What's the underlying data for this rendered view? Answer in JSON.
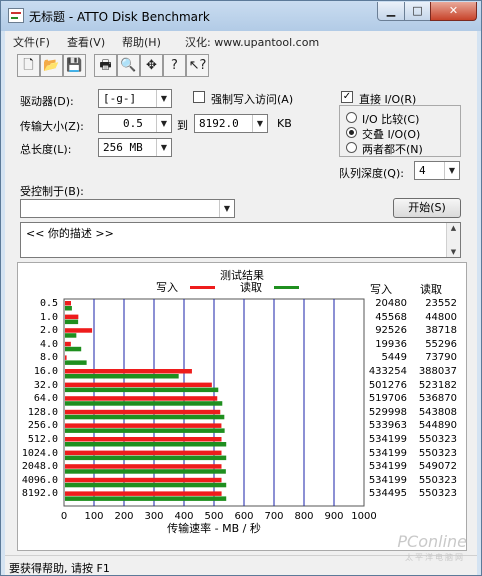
{
  "window": {
    "title": "无标题 - ATTO Disk Benchmark",
    "icon": "app-icon"
  },
  "menu": {
    "file": "文件(F)",
    "view": "查看(V)",
    "help": "帮助(H)",
    "localized": "汉化: www.upantool.com"
  },
  "toolbar": [
    "new-icon",
    "open-icon",
    "save-icon",
    "print-icon",
    "print-preview-icon",
    "move-icon",
    "help-icon",
    "context-help-icon"
  ],
  "form": {
    "drive_label": "驱动器(D):",
    "drive_value": "[-g-]",
    "force_write_label": "强制写入访问(A)",
    "force_write_checked": false,
    "transfer_label": "传输大小(Z):",
    "transfer_from": "0.5",
    "to_label": "到",
    "transfer_to": "8192.0",
    "kb_label": "KB",
    "total_label": "总长度(L):",
    "total_value": "256 MB",
    "direct_io_label": "直接 I/O(R)",
    "direct_io_checked": true,
    "radio_compare": "I/O 比较(C)",
    "radio_overlap": "交叠 I/O(O)",
    "radio_neither": "两者都不(N)",
    "selected_radio": "overlap",
    "queue_label": "队列深度(Q):",
    "queue_value": "4",
    "controlled_label": "受控制于(B):",
    "controlled_value": "",
    "start_button": "开始(S)",
    "description": "<<  你的描述  >>"
  },
  "results": {
    "title": "测试结果",
    "write_legend": "写入",
    "read_legend": "读取",
    "write_col": "写入",
    "read_col": "读取",
    "write_color": "#ee1c1c",
    "read_color": "#1f8f1f",
    "grid_color": "#1a22a8"
  },
  "chart_data": {
    "type": "bar",
    "orientation": "horizontal",
    "categories": [
      "0.5",
      "1.0",
      "2.0",
      "4.0",
      "8.0",
      "16.0",
      "32.0",
      "64.0",
      "128.0",
      "256.0",
      "512.0",
      "1024.0",
      "2048.0",
      "4096.0",
      "8192.0"
    ],
    "series": [
      {
        "name": "写入",
        "values": [
          20480,
          45568,
          92526,
          19936,
          5449,
          433254,
          501276,
          519706,
          529998,
          533963,
          534199,
          534199,
          534199,
          534199,
          534495
        ]
      },
      {
        "name": "读取",
        "values": [
          23552,
          44800,
          38718,
          55296,
          73790,
          388037,
          523182,
          536870,
          543808,
          544890,
          550323,
          550323,
          549072,
          550323,
          550323
        ]
      }
    ],
    "xlabel": "传输速率 - MB / 秒",
    "xlim": [
      0,
      1000
    ],
    "xticks": [
      "0",
      "100",
      "200",
      "300",
      "400",
      "500",
      "600",
      "700",
      "800",
      "900",
      "1000"
    ],
    "grid": true
  },
  "status": "要获得帮助, 请按 F1",
  "watermark": "PConline",
  "watermark_sub": "太平洋电脑网"
}
